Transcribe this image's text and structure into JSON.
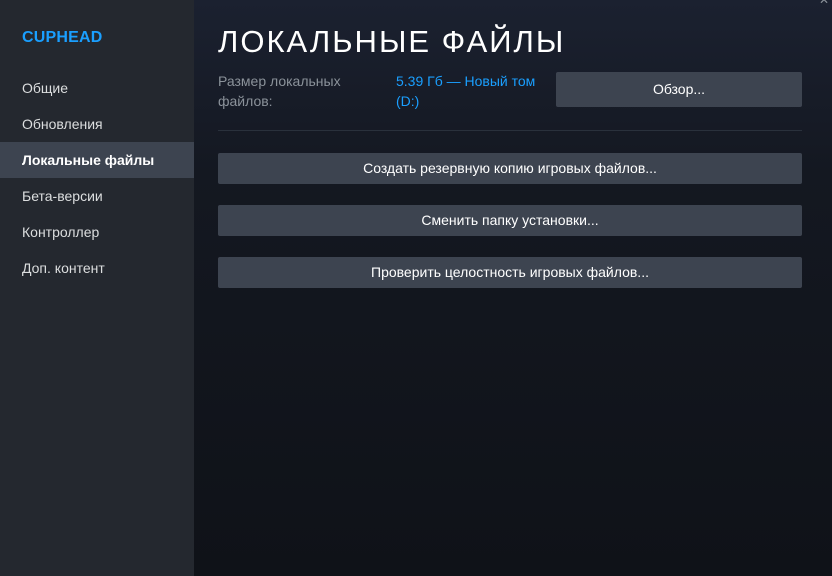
{
  "game": {
    "title": "CUPHEAD"
  },
  "sidebar": {
    "items": [
      {
        "label": "Общие"
      },
      {
        "label": "Обновления"
      },
      {
        "label": "Локальные файлы"
      },
      {
        "label": "Бета-версии"
      },
      {
        "label": "Контроллер"
      },
      {
        "label": "Доп. контент"
      }
    ],
    "active_index": 2
  },
  "page": {
    "title": "ЛОКАЛЬНЫЕ ФАЙЛЫ",
    "size_label": "Размер локальных файлов:",
    "size_value": "5.39 Гб — Новый том (D:)",
    "browse_label": "Обзор...",
    "backup_label": "Создать резервную копию игровых файлов...",
    "move_label": "Сменить папку установки...",
    "verify_label": "Проверить целостность игровых файлов..."
  },
  "window": {
    "close_symbol": "✕"
  },
  "colors": {
    "accent": "#1a9fff",
    "sidebar_bg": "#24282f",
    "active_item_bg": "#3d4450",
    "button_bg": "#3d4450",
    "main_bg": "#10141b"
  }
}
